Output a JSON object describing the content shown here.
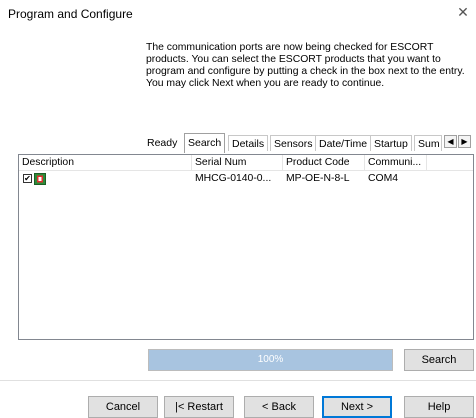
{
  "window": {
    "title": "Program and Configure",
    "close_glyph": "✕"
  },
  "intro_text": "The communication ports are now being checked for ESCORT products. You can select the ESCORT products that you want to program and configure by putting a check in the box next to the entry. You may click Next when you are ready to continue.",
  "tabs": [
    {
      "label": "Ready",
      "active": false
    },
    {
      "label": "Search",
      "active": true
    },
    {
      "label": "Details",
      "active": false
    },
    {
      "label": "Sensors",
      "active": false
    },
    {
      "label": "Date/Time",
      "active": false
    },
    {
      "label": "Startup",
      "active": false
    },
    {
      "label": "Sum",
      "active": false
    }
  ],
  "tab_scroll": {
    "left": "◀",
    "right": "▶"
  },
  "table": {
    "columns": [
      "Description",
      "Serial Num",
      "Product Code",
      "Communi..."
    ],
    "rows": [
      {
        "checked": true,
        "check_glyph": "✔",
        "icon": "device-icon",
        "serial": "MHCG-0140-0...",
        "product_code": "MP-OE-N-8-L",
        "comm": "COM4"
      }
    ]
  },
  "progress": {
    "percent": 100,
    "label": "100%"
  },
  "buttons": {
    "search": "Search",
    "cancel": "Cancel",
    "restart": "|< Restart",
    "back": "< Back",
    "next": "Next >",
    "help": "Help"
  },
  "colors": {
    "progress_fill": "#a8c4e0",
    "default_button_border": "#0078d7"
  }
}
